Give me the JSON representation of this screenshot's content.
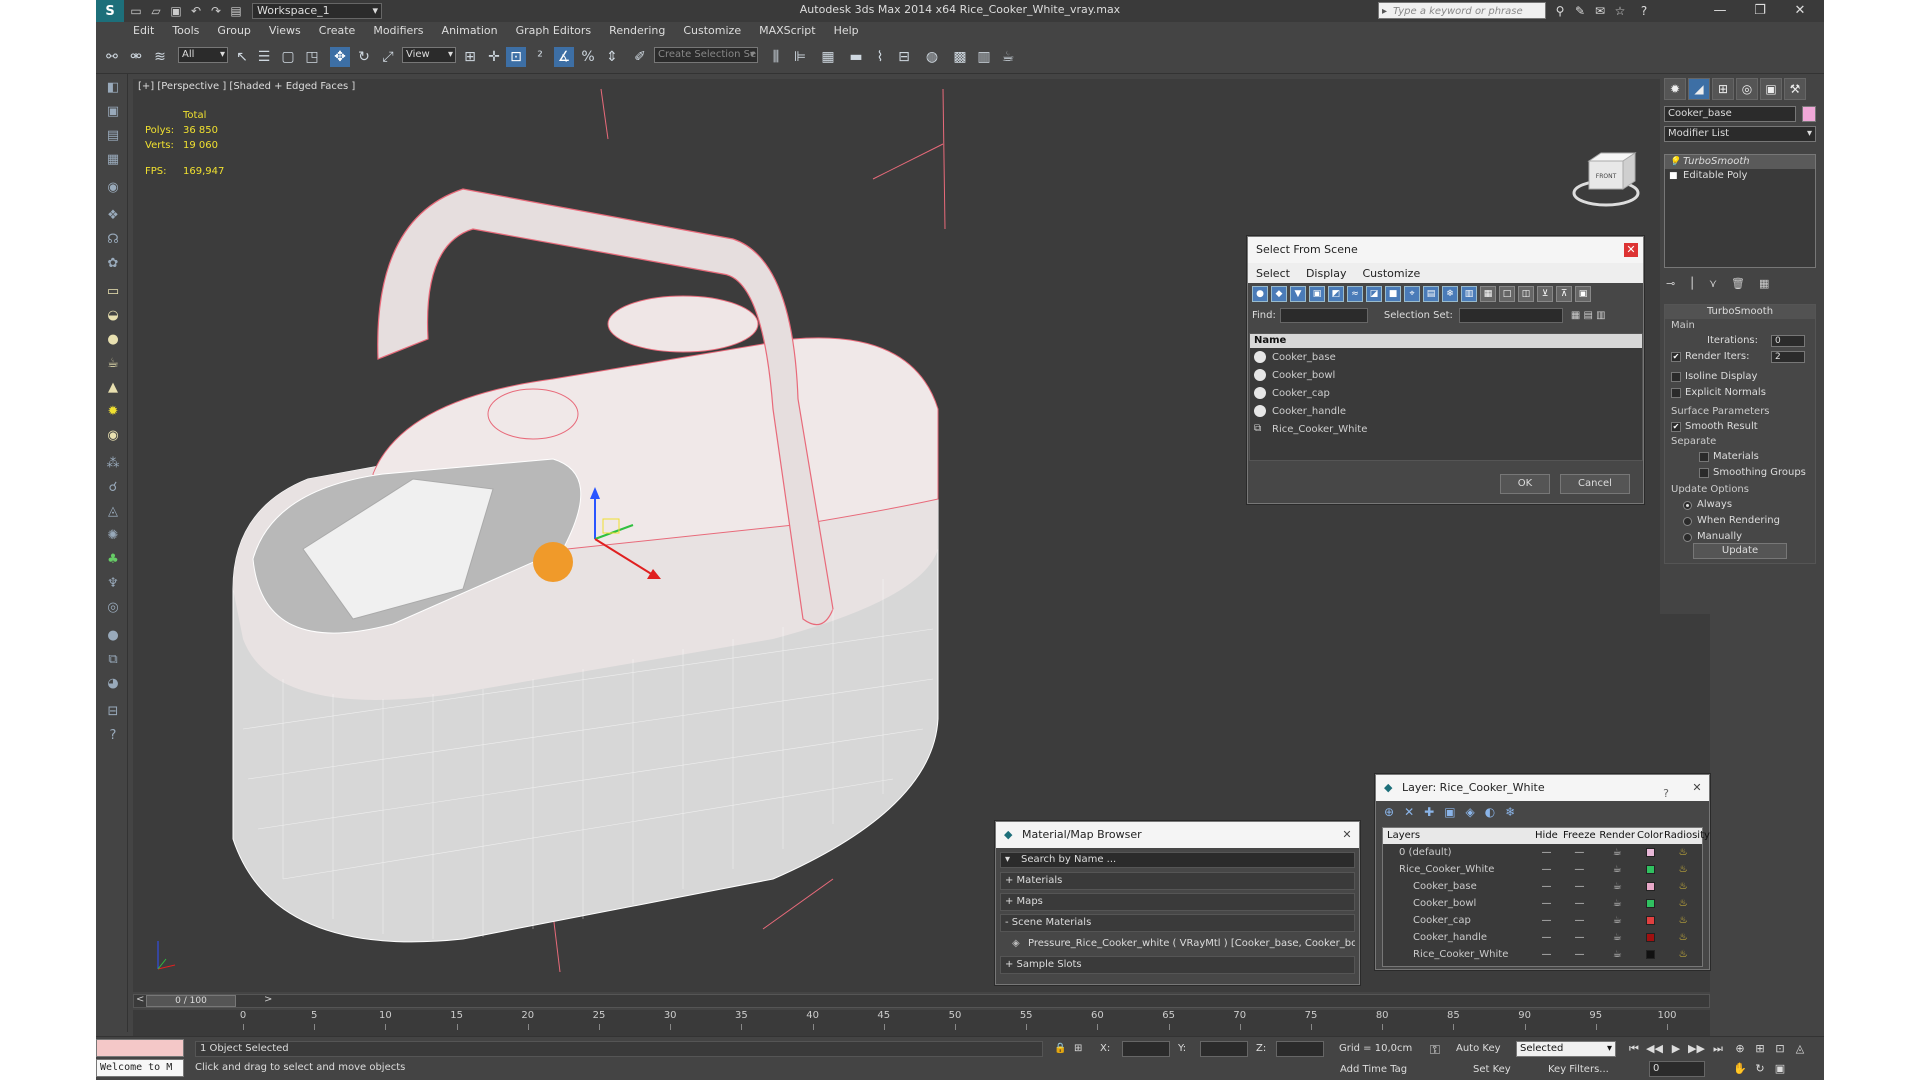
{
  "window": {
    "title": "Autodesk 3ds Max  2014 x64     Rice_Cooker_White_vray.max",
    "workspace": "Workspace_1",
    "search_placeholder": "Type a keyword or phrase",
    "minimize": "—",
    "maximize": "❐",
    "close": "✕"
  },
  "menu": [
    "Edit",
    "Tools",
    "Group",
    "Views",
    "Create",
    "Modifiers",
    "Animation",
    "Graph Editors",
    "Rendering",
    "Customize",
    "MAXScript",
    "Help"
  ],
  "toolbar": {
    "filter": "All",
    "ref_coord": "View",
    "selection_set_placeholder": "Create Selection Se"
  },
  "viewport": {
    "label": "[+] [Perspective ] [Shaded + Edged Faces ]",
    "stats": {
      "total_label": "Total",
      "polys_label": "Polys:",
      "polys_value": "36 850",
      "verts_label": "Verts:",
      "verts_value": "19 060",
      "fps_label": "FPS:",
      "fps_value": "169,947"
    },
    "viewcube_label": "FRONT"
  },
  "select_from_scene": {
    "title": "Select From Scene",
    "menu": [
      "Select",
      "Display",
      "Customize"
    ],
    "find_label": "Find:",
    "selection_set_label": "Selection Set:",
    "column_name": "Name",
    "items": [
      {
        "name": "Cooker_base",
        "type": "object"
      },
      {
        "name": "Cooker_bowl",
        "type": "object"
      },
      {
        "name": "Cooker_cap",
        "type": "object"
      },
      {
        "name": "Cooker_handle",
        "type": "object"
      },
      {
        "name": "Rice_Cooker_White",
        "type": "group"
      }
    ],
    "ok": "OK",
    "cancel": "Cancel"
  },
  "material_browser": {
    "title": "Material/Map Browser",
    "search_placeholder": "Search by Name ...",
    "sections": {
      "materials": "+ Materials",
      "maps": "+ Maps",
      "scene_materials": "- Scene Materials",
      "sample_slots": "+ Sample Slots"
    },
    "scene_material_item": "Pressure_Rice_Cooker_white ( VRayMtl ) [Cooker_base, Cooker_bowl, Cooker_cap, Cooker_handle]"
  },
  "layer_panel": {
    "title": "Layer: Rice_Cooker_White",
    "help": "?",
    "columns": {
      "layers": "Layers",
      "hide": "Hide",
      "freeze": "Freeze",
      "render": "Render",
      "color": "Color",
      "radiosity": "Radiosity"
    },
    "rows": [
      {
        "name": "0 (default)",
        "indent": 1,
        "color": "#e8b8d8",
        "current": false
      },
      {
        "name": "Rice_Cooker_White",
        "indent": 1,
        "color": "#30c060",
        "current": true
      },
      {
        "name": "Cooker_base",
        "indent": 2,
        "color": "#e8a8c8",
        "current": false
      },
      {
        "name": "Cooker_bowl",
        "indent": 2,
        "color": "#30c060",
        "current": false
      },
      {
        "name": "Cooker_cap",
        "indent": 2,
        "color": "#e04040",
        "current": false
      },
      {
        "name": "Cooker_handle",
        "indent": 2,
        "color": "#a01010",
        "current": false
      },
      {
        "name": "Rice_Cooker_White",
        "indent": 2,
        "color": "#111111",
        "current": false
      }
    ]
  },
  "command_panel": {
    "object_name": "Cooker_base",
    "object_color": "#f0a8d8",
    "modifier_list": "Modifier List",
    "stack": [
      "TurboSmooth",
      "Editable Poly"
    ],
    "turbosmooth": {
      "title": "TurboSmooth",
      "main": "Main",
      "iterations_label": "Iterations:",
      "iterations_value": "0",
      "render_iters_label": "Render Iters:",
      "render_iters_value": "2",
      "render_iters_checked": true,
      "isoline_display": "Isoline Display",
      "explicit_normals": "Explicit Normals",
      "surface_parameters": "Surface Parameters",
      "smooth_result": "Smooth Result",
      "separate": "Separate",
      "materials": "Materials",
      "smoothing_groups": "Smoothing Groups",
      "update_options": "Update Options",
      "always": "Always",
      "when_rendering": "When Rendering",
      "manually": "Manually",
      "update_button": "Update"
    }
  },
  "timeline": {
    "frame_display": "0 / 100",
    "ticks": [
      "0",
      "5",
      "10",
      "15",
      "20",
      "25",
      "30",
      "35",
      "40",
      "45",
      "50",
      "55",
      "60",
      "65",
      "70",
      "75",
      "80",
      "85",
      "90",
      "95",
      "100"
    ]
  },
  "status": {
    "maxscript_listener": "Welcome to M",
    "selection": "1 Object Selected",
    "prompt": "Click and drag to select and move objects",
    "x_label": "X:",
    "y_label": "Y:",
    "z_label": "Z:",
    "grid": "Grid = 10,0cm",
    "add_time_tag": "Add Time Tag",
    "auto_key": "Auto Key",
    "set_key": "Set Key",
    "selected": "Selected",
    "key_filters": "Key Filters...",
    "current_frame": "0"
  },
  "colors": {
    "ui_bg": "#444444",
    "viewport_bg": "#3c3c3c",
    "accent": "#3d6fa5",
    "stats_text": "#f0e030",
    "wire_selected": "#e04040"
  }
}
